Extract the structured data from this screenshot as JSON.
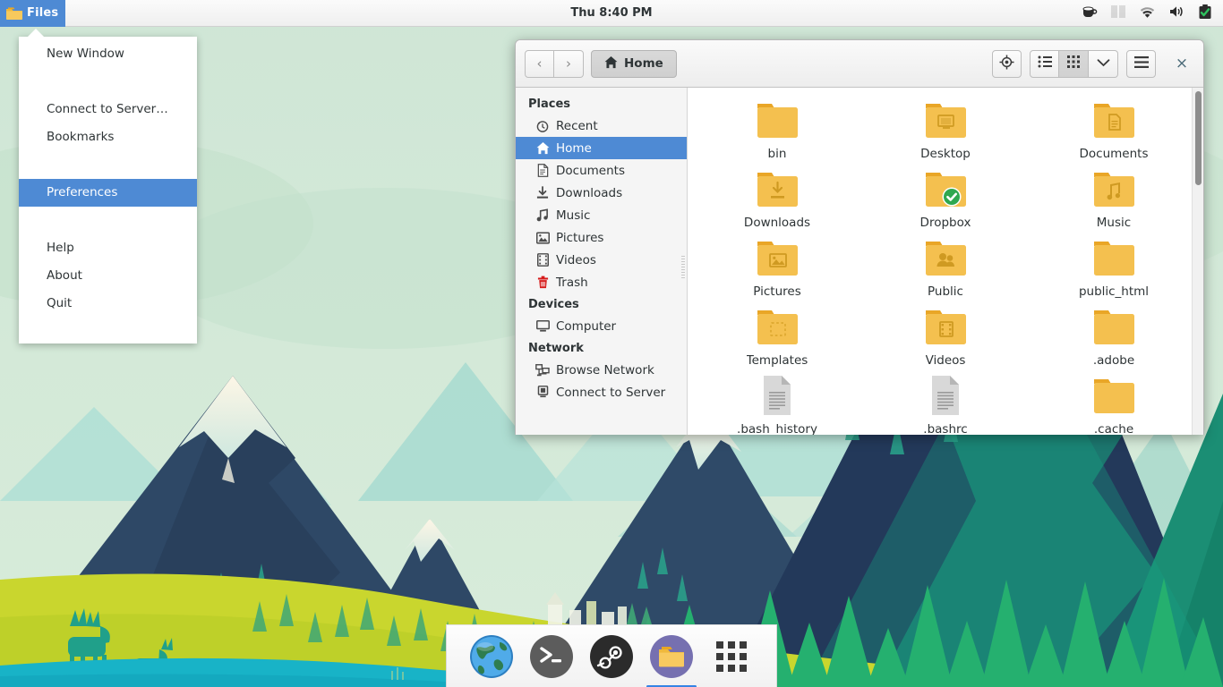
{
  "panel": {
    "app_button": {
      "label": "Files",
      "icon": "folder-icon"
    },
    "clock": "Thu  8:40 PM",
    "tray": [
      {
        "name": "coffee-cup-icon",
        "label": "Caffeine"
      },
      {
        "name": "window-list-icon",
        "label": "Workspaces"
      },
      {
        "name": "wifi-icon",
        "label": "Network"
      },
      {
        "name": "volume-icon",
        "label": "Sound"
      },
      {
        "name": "battery-icon",
        "label": "Battery"
      }
    ]
  },
  "app_menu": {
    "items": [
      {
        "label": "New Window",
        "selected": false
      },
      {
        "label": "Connect to Server…",
        "selected": false
      },
      {
        "label": "Bookmarks",
        "selected": false
      },
      {
        "label": "Preferences",
        "selected": true
      },
      {
        "label": "Help",
        "selected": false
      },
      {
        "label": "About",
        "selected": false
      },
      {
        "label": "Quit",
        "selected": false
      }
    ]
  },
  "window": {
    "path_button": "Home",
    "nav": {
      "back": "‹",
      "forward": "›"
    },
    "toolbar": {
      "location_label": "Location",
      "list_view_label": "List view",
      "grid_view_label": "Grid view",
      "options_label": "View options",
      "menu_label": "Main menu",
      "close_label": "×"
    },
    "sidebar": {
      "sections": [
        {
          "title": "Places",
          "items": [
            {
              "label": "Recent",
              "icon": "recent-icon",
              "selected": false
            },
            {
              "label": "Home",
              "icon": "home-icon",
              "selected": true
            },
            {
              "label": "Documents",
              "icon": "document-icon",
              "selected": false
            },
            {
              "label": "Downloads",
              "icon": "download-icon",
              "selected": false
            },
            {
              "label": "Music",
              "icon": "music-icon",
              "selected": false
            },
            {
              "label": "Pictures",
              "icon": "picture-icon",
              "selected": false
            },
            {
              "label": "Videos",
              "icon": "video-icon",
              "selected": false
            },
            {
              "label": "Trash",
              "icon": "trash-icon",
              "selected": false
            }
          ]
        },
        {
          "title": "Devices",
          "items": [
            {
              "label": "Computer",
              "icon": "computer-icon",
              "selected": false
            }
          ]
        },
        {
          "title": "Network",
          "items": [
            {
              "label": "Browse Network",
              "icon": "network-icon",
              "selected": false
            },
            {
              "label": "Connect to Server",
              "icon": "server-icon",
              "selected": false
            }
          ]
        }
      ]
    },
    "files": [
      {
        "name": "bin",
        "type": "folder",
        "emblem": "none",
        "badge": "none"
      },
      {
        "name": "Desktop",
        "type": "folder",
        "emblem": "desktop",
        "badge": "none"
      },
      {
        "name": "Documents",
        "type": "folder",
        "emblem": "document",
        "badge": "none"
      },
      {
        "name": "Downloads",
        "type": "folder",
        "emblem": "download",
        "badge": "none"
      },
      {
        "name": "Dropbox",
        "type": "folder",
        "emblem": "none",
        "badge": "check"
      },
      {
        "name": "Music",
        "type": "folder",
        "emblem": "music",
        "badge": "none"
      },
      {
        "name": "Pictures",
        "type": "folder",
        "emblem": "picture",
        "badge": "none"
      },
      {
        "name": "Public",
        "type": "folder",
        "emblem": "people",
        "badge": "none"
      },
      {
        "name": "public_html",
        "type": "folder",
        "emblem": "none",
        "badge": "none"
      },
      {
        "name": "Templates",
        "type": "folder",
        "emblem": "template",
        "badge": "none"
      },
      {
        "name": "Videos",
        "type": "folder",
        "emblem": "video",
        "badge": "none"
      },
      {
        "name": ".adobe",
        "type": "folder",
        "emblem": "none",
        "badge": "none"
      },
      {
        "name": ".bash_history",
        "type": "file",
        "emblem": "none",
        "badge": "none"
      },
      {
        "name": ".bashrc",
        "type": "file",
        "emblem": "none",
        "badge": "none"
      },
      {
        "name": ".cache",
        "type": "folder",
        "emblem": "none",
        "badge": "none"
      }
    ]
  },
  "dock": {
    "items": [
      {
        "name": "web-browser-icon",
        "label": "Web Browser",
        "running": false
      },
      {
        "name": "terminal-icon",
        "label": "Terminal",
        "running": false
      },
      {
        "name": "steam-icon",
        "label": "Steam",
        "running": false
      },
      {
        "name": "files-icon",
        "label": "Files",
        "running": true
      },
      {
        "name": "app-grid-icon",
        "label": "Show Applications",
        "running": false
      }
    ]
  },
  "colors": {
    "accent": "#4e8ad4",
    "folder": "#f4c04f",
    "folder_tab": "#e9a627",
    "panel_bg": "#f5f5f5",
    "running_indicator": "#3584e4",
    "check_green": "#2fa84f"
  }
}
